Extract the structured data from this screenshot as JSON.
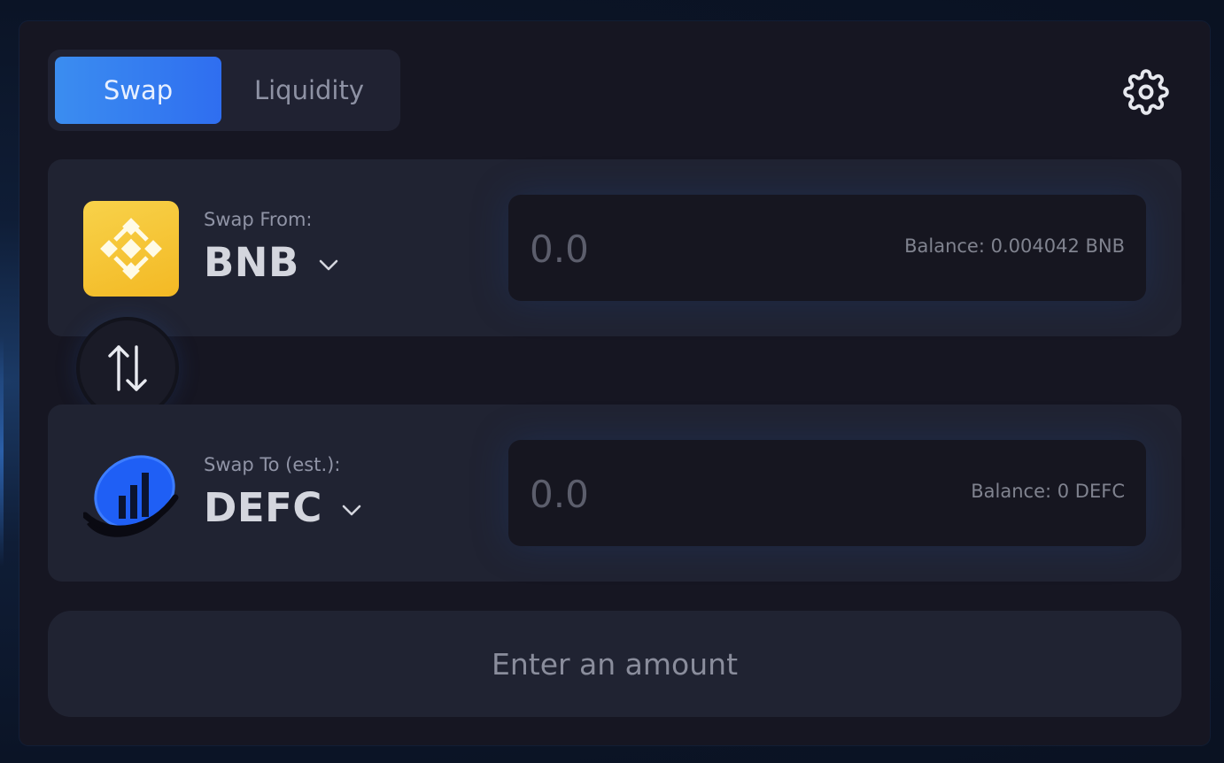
{
  "tabs": [
    {
      "label": "Swap",
      "active": true
    },
    {
      "label": "Liquidity",
      "active": false
    }
  ],
  "settings_icon": "gear-icon",
  "from": {
    "label": "Swap From:",
    "token": "BNB",
    "token_icon": "bnb-logo-icon",
    "amount_placeholder": "0.0",
    "amount_value": "",
    "balance": "Balance: 0.004042 BNB"
  },
  "switch_icon": "swap-arrows-icon",
  "to": {
    "label": "Swap To (est.):",
    "token": "DEFC",
    "token_icon": "defc-logo-icon",
    "amount_placeholder": "0.0",
    "amount_value": "",
    "balance": "Balance: 0 DEFC"
  },
  "action_button": "Enter an amount",
  "colors": {
    "accent": "#2f6ef0",
    "bnb_yellow": "#f3b924",
    "defc_blue": "#1f5ff5"
  }
}
